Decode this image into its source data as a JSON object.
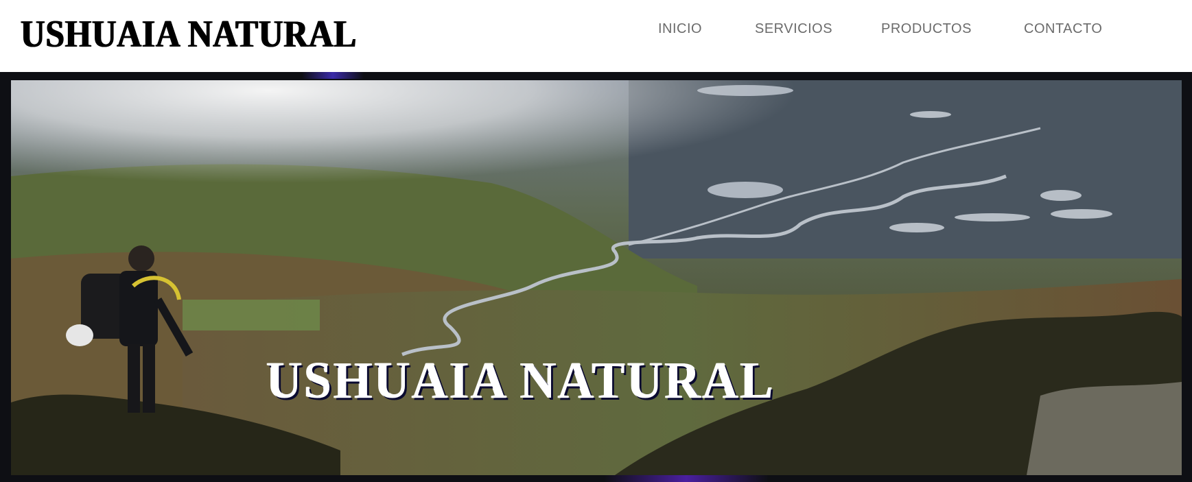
{
  "header": {
    "logo_text": "USHUAIA NATURAL",
    "nav": [
      {
        "label": "INICIO"
      },
      {
        "label": "SERVICIOS"
      },
      {
        "label": "PRODUCTOS"
      },
      {
        "label": "CONTACTO"
      }
    ]
  },
  "hero": {
    "title": "USHUAIA NATURAL"
  },
  "colors": {
    "nav_text": "#6b6b6b",
    "logo": "#000000",
    "frame": "#0e0f14",
    "hero_title": "#ffffff"
  }
}
